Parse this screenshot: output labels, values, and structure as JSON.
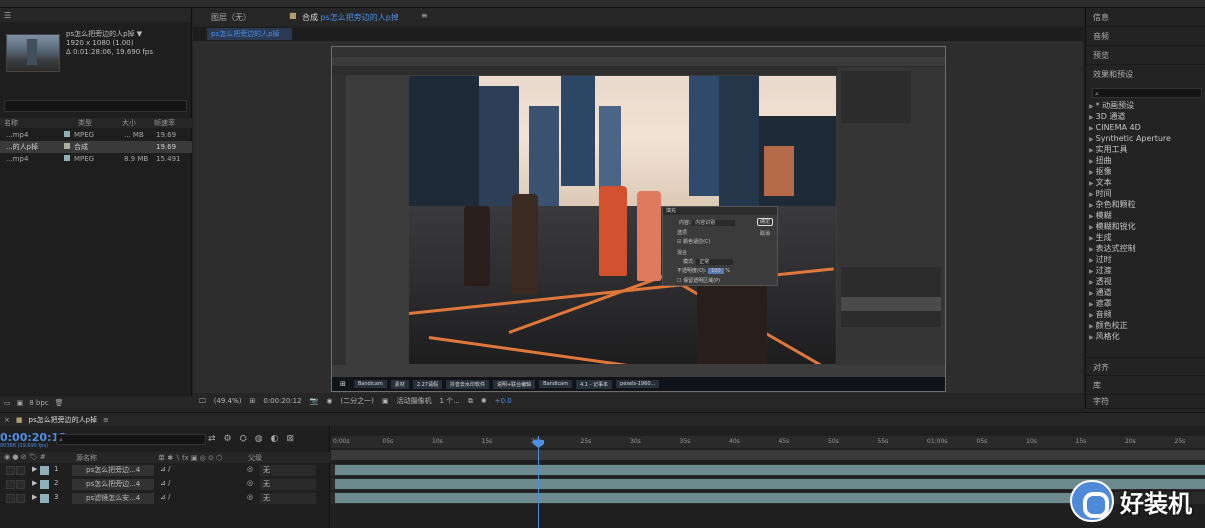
{
  "project": {
    "item_name": "ps怎么把旁边的人p掉",
    "item_arrow": "▼",
    "item_res": "1920 x 1080 (1.00)",
    "item_dur": "Δ 0:01:28:06, 19.690 fps",
    "columns": [
      "名称",
      "类型",
      "大小",
      "帧速率"
    ],
    "rows": [
      {
        "name": "...mp4",
        "type": "MPEG",
        "size": "... MB",
        "fps": "19.69",
        "color": "#8fb0b8"
      },
      {
        "name": "...的人p掉",
        "type": "合成",
        "size": "",
        "fps": "19.69",
        "color": "#b0b0a0"
      },
      {
        "name": "...mp4",
        "type": "MPEG",
        "size": "8.9 MB",
        "fps": "15.491",
        "color": "#8fb0b8"
      }
    ],
    "bpc": "8 bpc"
  },
  "viewer": {
    "layer_tab": "图层（无）",
    "comp_tab_prefix": "合成",
    "comp_tab_name": "ps怎么把旁边的人p掉",
    "sub_tab": "ps怎么把旁边的人p掉",
    "zoom": "(49.4%)",
    "timecode": "0:00:20:12",
    "resolution": "(二分之一)",
    "camera": "活动摄像机",
    "views": "1 个...",
    "exposure": "+0.0"
  },
  "ps_dialog": {
    "title": "填充",
    "ok": "确定",
    "cancel": "取消",
    "content_label": "内容:",
    "content_value": "内容识别",
    "options": "选项",
    "color_adapt": "颜色适应(C)",
    "blending": "混合",
    "mode_label": "模式:",
    "mode_value": "正常",
    "opacity_label": "不透明度(O):",
    "opacity_value": "100",
    "preserve": "保留透明区域(P)"
  },
  "ps_taskbar": [
    "Bandicam",
    "素材",
    "2.27请假",
    "抖音去水印软件",
    "说明+联合编辑",
    "Bandicam",
    "4.1 - 记事本",
    "pexels-1960..."
  ],
  "effects": {
    "panels": [
      "信息",
      "音频",
      "预览",
      "效果和预设"
    ],
    "categories": [
      "* 动画预设",
      "3D 通道",
      "CINEMA 4D",
      "Synthetic Aperture",
      "实用工具",
      "扭曲",
      "抠像",
      "文本",
      "时间",
      "杂色和颗粒",
      "模糊",
      "模糊和锐化",
      "生成",
      "表达式控制",
      "过时",
      "过渡",
      "透视",
      "通道",
      "遮罩",
      "音频",
      "颜色校正",
      "风格化"
    ],
    "bottom": [
      "对齐",
      "库",
      "字符"
    ]
  },
  "timeline": {
    "tab": "ps怎么把旁边的人p掉",
    "timecode": "0:00:20:12",
    "timecode_sub": "00386 (19.690 fps)",
    "col_source": "源名称",
    "col_parent": "父级",
    "layers": [
      {
        "num": "1",
        "name": "ps怎么把旁边...4",
        "parent": "无"
      },
      {
        "num": "2",
        "name": "ps怎么把旁边...4",
        "parent": "无"
      },
      {
        "num": "3",
        "name": "ps滤镜怎么安...4",
        "parent": "无"
      }
    ],
    "ruler": [
      "0:00s",
      "05s",
      "10s",
      "15s",
      "20s",
      "25s",
      "30s",
      "35s",
      "40s",
      "45s",
      "50s",
      "55s",
      "01:00s",
      "05s",
      "10s",
      "15s",
      "20s",
      "25s"
    ],
    "playhead_seconds": 20.6
  },
  "watermark": "好装机"
}
